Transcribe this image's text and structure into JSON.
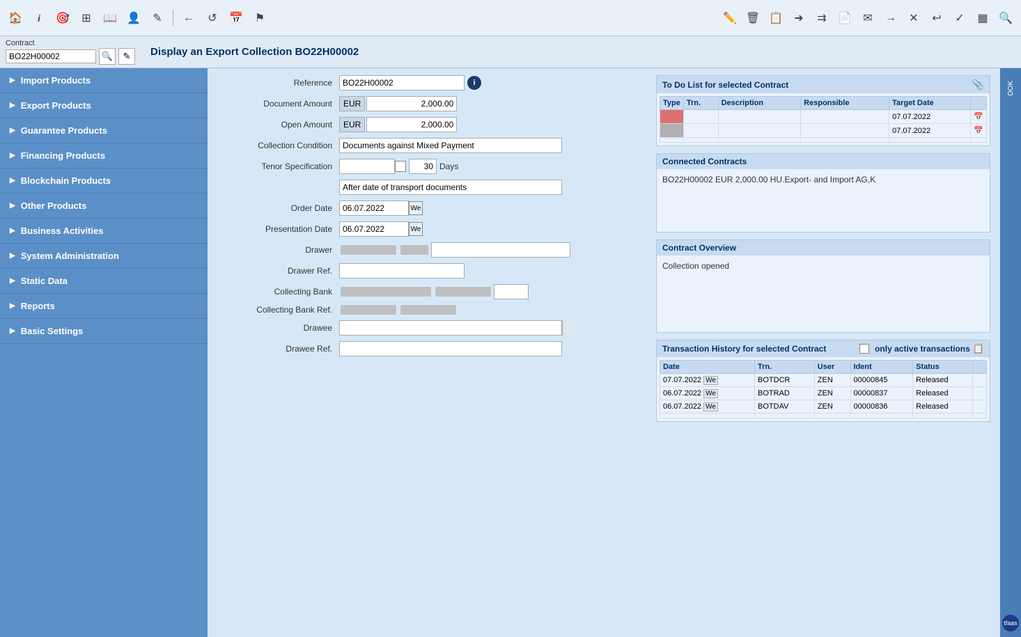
{
  "toolbar": {
    "icons_left": [
      "home",
      "info",
      "target",
      "layers",
      "book",
      "person",
      "edit",
      "back",
      "refresh",
      "calendar",
      "flag"
    ],
    "icons_right": [
      "pencil",
      "trash",
      "copy",
      "forward",
      "merge",
      "page",
      "mail",
      "arrow-right",
      "close",
      "undo",
      "check",
      "table",
      "search"
    ]
  },
  "contract_bar": {
    "label": "Contract",
    "value": "BO22H00002"
  },
  "page_title": "Display an Export Collection BO22H00002",
  "sidebar": {
    "items": [
      {
        "label": "Import Products",
        "expanded": false
      },
      {
        "label": "Export Products",
        "expanded": false
      },
      {
        "label": "Guarantee Products",
        "expanded": false
      },
      {
        "label": "Financing Products",
        "expanded": false
      },
      {
        "label": "Blockchain Products",
        "expanded": false
      },
      {
        "label": "Other Products",
        "expanded": false
      },
      {
        "label": "Business Activities",
        "expanded": false
      },
      {
        "label": "System Administration",
        "expanded": false
      },
      {
        "label": "Static Data",
        "expanded": false
      },
      {
        "label": "Reports",
        "expanded": false
      },
      {
        "label": "Basic Settings",
        "expanded": false
      }
    ]
  },
  "form": {
    "reference_label": "Reference",
    "reference_value": "BO22H00002",
    "document_amount_label": "Document Amount",
    "document_amount_currency": "EUR",
    "document_amount_value": "2,000.00",
    "open_amount_label": "Open Amount",
    "open_amount_currency": "EUR",
    "open_amount_value": "2,000.00",
    "collection_condition_label": "Collection Condition",
    "collection_condition_value": "Documents against Mixed Payment",
    "tenor_specification_label": "Tenor Specification",
    "tenor_days": "30",
    "tenor_days_unit": "Days",
    "tenor_text_value": "After date of transport documents",
    "order_date_label": "Order Date",
    "order_date_value": "06.07.2022",
    "presentation_date_label": "Presentation Date",
    "presentation_date_value": "06.07.2022",
    "drawer_label": "Drawer",
    "drawer_ref_label": "Drawer Ref.",
    "collecting_bank_label": "Collecting Bank",
    "collecting_bank_ref_label": "Collecting Bank Ref.",
    "drawee_label": "Drawee",
    "drawee_ref_label": "Drawee Ref."
  },
  "todo_panel": {
    "title": "To Do List for selected Contract",
    "columns": [
      "Type",
      "Trn.",
      "Description",
      "Responsible",
      "Target Date"
    ],
    "rows": [
      {
        "type": "red",
        "trn": "",
        "description": "",
        "responsible": "",
        "target_date": "07.07.2022"
      },
      {
        "type": "gray",
        "trn": "",
        "description": "",
        "responsible": "",
        "target_date": "07.07.2022"
      }
    ]
  },
  "connected_contracts": {
    "title": "Connected Contracts",
    "value": "BO22H00002 EUR 2,000.00 HU.Export- and Import AG,K"
  },
  "contract_overview": {
    "title": "Contract Overview",
    "value": "Collection opened"
  },
  "transaction_history": {
    "title": "Transaction History for selected Contract",
    "only_active_label": "only active transactions",
    "columns": [
      "Date",
      "Trn.",
      "User",
      "Ident",
      "Status"
    ],
    "rows": [
      {
        "date": "07.07.2022",
        "trn": "BOTDCR",
        "user": "ZEN",
        "ident": "00000845",
        "status": "Released"
      },
      {
        "date": "06.07.2022",
        "trn": "BOTRAD",
        "user": "ZEN",
        "ident": "00000837",
        "status": "Released"
      },
      {
        "date": "06.07.2022",
        "trn": "BOTDAV",
        "user": "ZEN",
        "ident": "00000836",
        "status": "Released"
      }
    ]
  },
  "right_sidebar_label": "DOK",
  "username": "tfaas"
}
